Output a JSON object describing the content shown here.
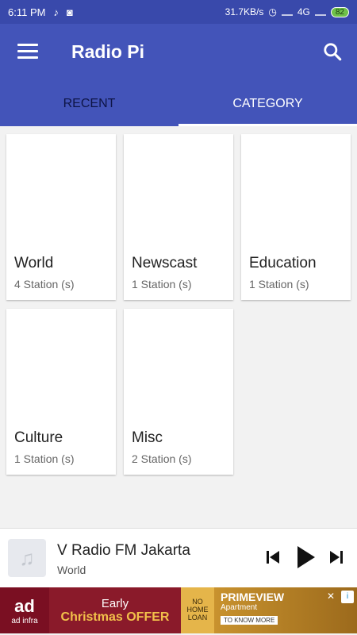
{
  "status_bar": {
    "time": "6:11 PM",
    "speed": "31.7KB/s",
    "network": "4G",
    "battery": "82"
  },
  "app_bar": {
    "title": "Radio Pi"
  },
  "tabs": [
    {
      "label": "RECENT",
      "active": false
    },
    {
      "label": "CATEGORY",
      "active": true
    }
  ],
  "categories": [
    {
      "name": "World",
      "count": "4 Station (s)"
    },
    {
      "name": "Newscast",
      "count": "1 Station (s)"
    },
    {
      "name": "Education",
      "count": "1 Station (s)"
    },
    {
      "name": "Culture",
      "count": "1 Station (s)"
    },
    {
      "name": "Misc",
      "count": "2 Station (s)"
    }
  ],
  "player": {
    "title": "V Radio FM Jakarta",
    "subtitle": "World"
  },
  "ad": {
    "logo_text": "ad",
    "logo_sub": "ad infra",
    "offer_line1": "Early",
    "offer_line2": "Christmas OFFER",
    "noloan": "NO HOME LOAN",
    "prime_title": "PRIMEVIEW",
    "prime_sub": "Apartment",
    "prime_cta": "TO KNOW MORE"
  },
  "colors": {
    "primary": "#4354b9",
    "status": "#3949ab"
  }
}
